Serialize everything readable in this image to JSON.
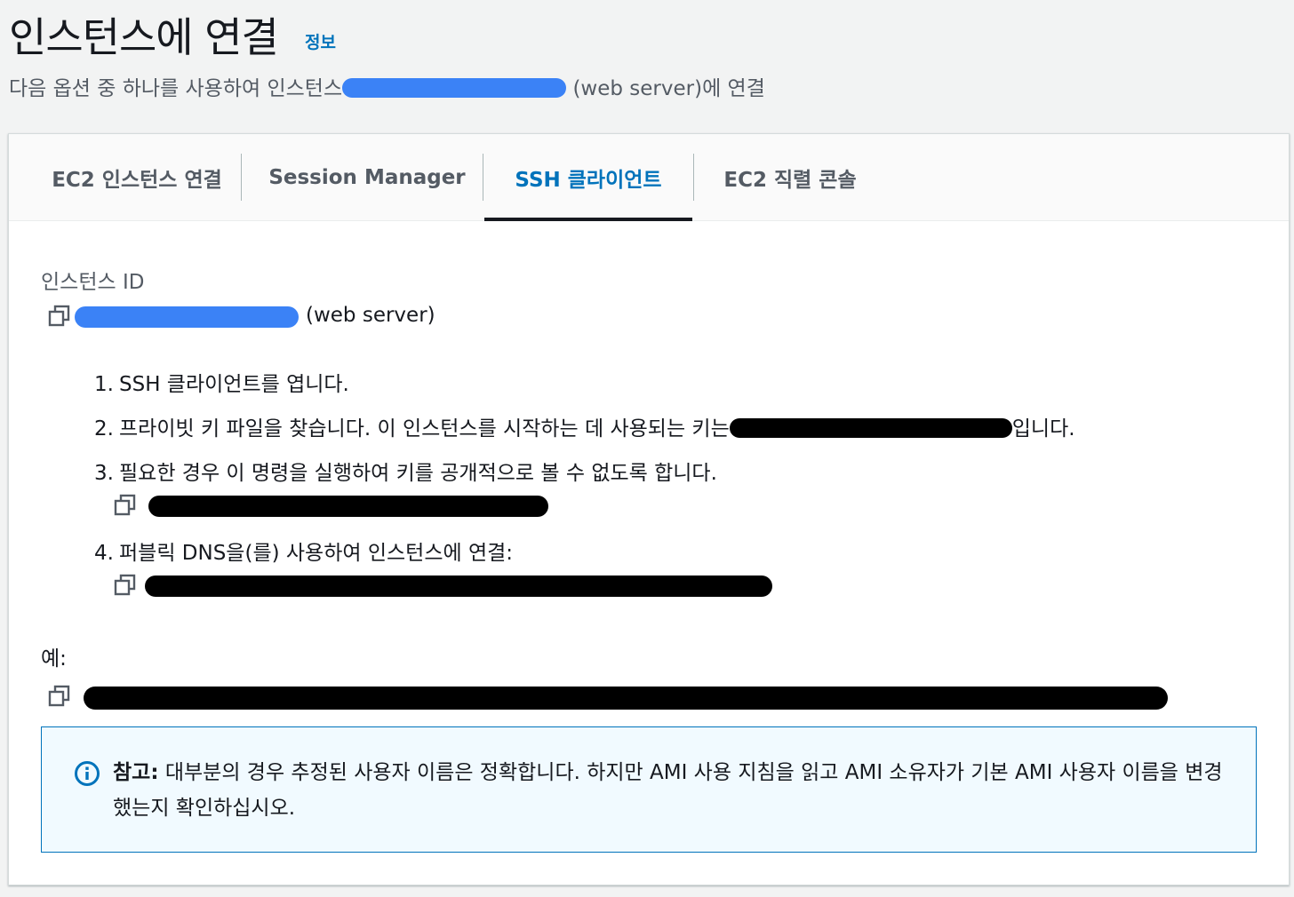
{
  "header": {
    "title": "인스턴스에 연결",
    "info_link": "정보",
    "subtitle_prefix": "다음 옵션 중 하나를 사용하여 인스턴스",
    "subtitle_suffix": "(web server)에 연결"
  },
  "tabs": [
    {
      "label": "EC2 인스턴스 연결",
      "active": false
    },
    {
      "label": "Session Manager",
      "active": false
    },
    {
      "label": "SSH 클라이언트",
      "active": true
    },
    {
      "label": "EC2 직렬 콘솔",
      "active": false
    }
  ],
  "instance": {
    "label": "인스턴스 ID",
    "suffix": "(web server)"
  },
  "steps": [
    {
      "num": "1.",
      "text": "SSH 클라이언트를 엽니다."
    },
    {
      "num": "2.",
      "text": "프라이빗 키 파일을 찾습니다. 이 인스턴스를 시작하는 데 사용되는 키는",
      "text_after": "입니다."
    },
    {
      "num": "3.",
      "text": "필요한 경우 이 명령을 실행하여 키를 공개적으로 볼 수 없도록 합니다."
    },
    {
      "num": "4.",
      "text": "퍼블릭 DNS을(를) 사용하여 인스턴스에 연결:"
    }
  ],
  "example": {
    "label": "예:"
  },
  "note": {
    "title": "참고:",
    "text": "대부분의 경우 추정된 사용자 이름은 정확합니다. 하지만 AMI 사용 지침을 읽고 AMI 소유자가 기본 AMI 사용자 이름을 변경했는지 확인하십시오."
  },
  "icons": {
    "copy": "copy-icon",
    "info": "info-circle-icon"
  },
  "colors": {
    "accent": "#0073bb",
    "active_tab_underline": "#16191f",
    "note_bg": "#f1faff",
    "note_border": "#0073bb"
  }
}
